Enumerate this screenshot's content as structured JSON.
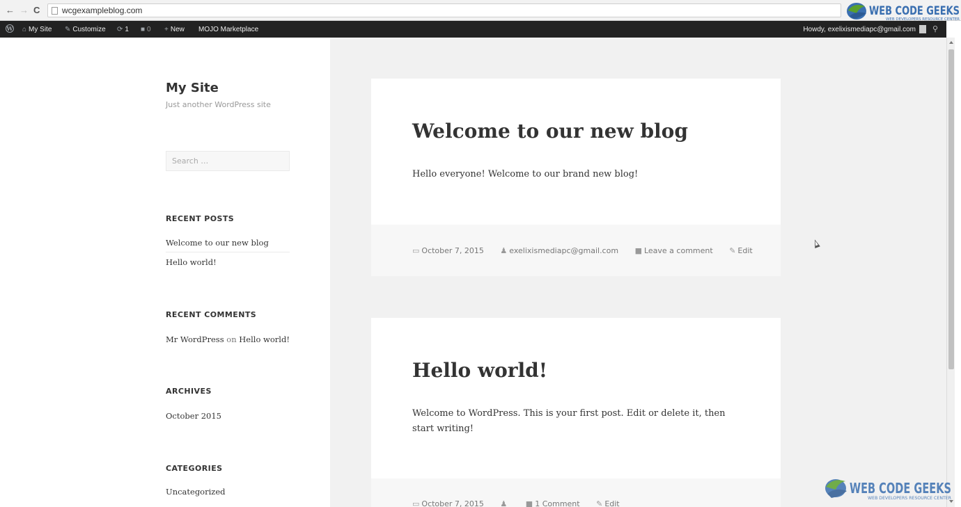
{
  "browser": {
    "url": "wcgexampleblog.com",
    "back_glyph": "←",
    "forward_glyph": "→",
    "reload_glyph": "C"
  },
  "watermark": {
    "brand": "WEB CODE GEEKS",
    "tagline": "WEB DEVELOPERS RESOURCE CENTER",
    "brand_color": "#3a6fb0",
    "leaf_color": "#5aa02c"
  },
  "adminbar": {
    "wp_icon": "wordpress-logo-icon",
    "my_site": "My Site",
    "customize": "Customize",
    "updates": "1",
    "comments": "0",
    "new_label": "New",
    "marketplace": "MOJO Marketplace",
    "howdy": "Howdy, exelixismediapc@gmail.com"
  },
  "sidebar": {
    "site_title": "My Site",
    "site_desc": "Just another WordPress site",
    "search_placeholder": "Search …",
    "recent_posts": {
      "title": "RECENT POSTS",
      "items": [
        "Welcome to our new blog",
        "Hello world!"
      ]
    },
    "recent_comments": {
      "title": "RECENT COMMENTS",
      "author": "Mr WordPress",
      "on": "on",
      "post": "Hello world!"
    },
    "archives": {
      "title": "ARCHIVES",
      "items": [
        "October 2015"
      ]
    },
    "categories": {
      "title": "CATEGORIES",
      "items": [
        "Uncategorized"
      ]
    }
  },
  "posts": [
    {
      "title": "Welcome to our new blog",
      "excerpt": "Hello everyone! Welcome to our brand new blog!",
      "date": "October 7, 2015",
      "author": "exelixismediapc@gmail.com",
      "comments": "Leave a comment",
      "edit": "Edit"
    },
    {
      "title": "Hello world!",
      "excerpt": "Welcome to WordPress. This is your first post. Edit or delete it, then start writing!",
      "date": "October 7, 2015",
      "author": "",
      "comments": "1 Comment",
      "edit": "Edit"
    }
  ]
}
